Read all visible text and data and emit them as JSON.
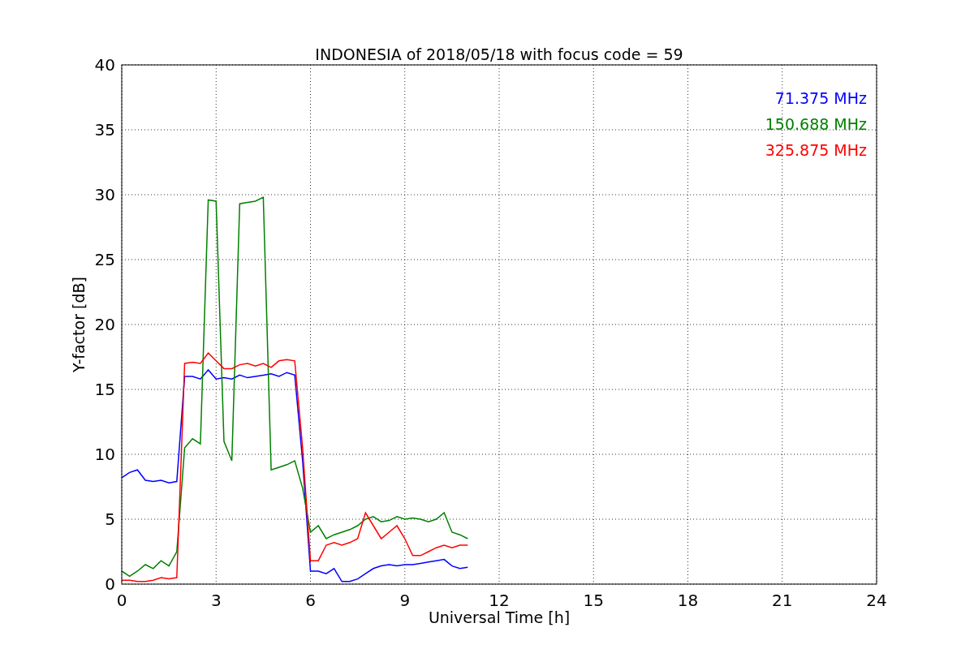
{
  "figure": {
    "chart_data": {
      "type": "line",
      "title": "INDONESIA of 2018/05/18 with focus code = 59",
      "xlabel": "Universal Time [h]",
      "ylabel": "Y-factor [dB]",
      "x": [
        0,
        0.25,
        0.5,
        0.75,
        1,
        1.25,
        1.5,
        1.75,
        2,
        2.25,
        2.5,
        2.75,
        3,
        3.25,
        3.5,
        3.75,
        4,
        4.25,
        4.5,
        4.75,
        5,
        5.25,
        5.5,
        5.75,
        6,
        6.25,
        6.5,
        6.75,
        7,
        7.25,
        7.5,
        7.75,
        8,
        8.25,
        8.5,
        8.75,
        9,
        9.25,
        9.5,
        9.75,
        10,
        10.25,
        10.5,
        10.75,
        11
      ],
      "series": [
        {
          "name": "71.375 MHz",
          "color": "#0000ff",
          "values": [
            8.2,
            8.6,
            8.8,
            8.0,
            7.9,
            8.0,
            7.8,
            7.9,
            16,
            16,
            15.8,
            16.5,
            15.8,
            15.9,
            15.8,
            16.1,
            15.9,
            16,
            16.1,
            16.2,
            16.0,
            16.3,
            16.1,
            9.5,
            1.0,
            1.0,
            0.8,
            1.2,
            0.2,
            0.2,
            0.4,
            0.8,
            1.2,
            1.4,
            1.5,
            1.4,
            1.5,
            1.5,
            1.6,
            1.7,
            1.8,
            1.9,
            1.4,
            1.2,
            1.3
          ]
        },
        {
          "name": "150.688 MHz",
          "color": "#008000",
          "values": [
            1.0,
            0.6,
            1.0,
            1.5,
            1.2,
            1.8,
            1.4,
            2.5,
            10.5,
            11.2,
            10.8,
            29.6,
            29.5,
            11,
            9.5,
            29.3,
            29.4,
            29.5,
            29.8,
            8.8,
            9.0,
            9.2,
            9.5,
            7.4,
            4.0,
            4.5,
            3.5,
            3.8,
            4.0,
            4.2,
            4.5,
            5.0,
            5.2,
            4.8,
            4.9,
            5.2,
            5.0,
            5.1,
            5.0,
            4.8,
            5.0,
            5.5,
            4.0,
            3.8,
            3.5
          ]
        },
        {
          "name": "325.875 MHz",
          "color": "#ff0000",
          "values": [
            0.3,
            0.3,
            0.2,
            0.2,
            0.3,
            0.5,
            0.4,
            0.5,
            17,
            17.1,
            17.0,
            17.8,
            17.2,
            16.6,
            16.6,
            16.9,
            17.0,
            16.8,
            17.0,
            16.7,
            17.2,
            17.3,
            17.2,
            10.5,
            1.8,
            1.8,
            3.0,
            3.2,
            3.0,
            3.2,
            3.5,
            5.5,
            4.5,
            3.5,
            4.0,
            4.5,
            3.5,
            2.2,
            2.2,
            2.5,
            2.8,
            3.0,
            2.8,
            3.0,
            3.0
          ]
        }
      ],
      "xlim": [
        0,
        24
      ],
      "ylim": [
        0,
        40
      ],
      "xticks": [
        0,
        3,
        6,
        9,
        12,
        15,
        18,
        21,
        24
      ],
      "yticks": [
        0,
        5,
        10,
        15,
        20,
        25,
        30,
        35,
        40
      ],
      "grid": true
    }
  }
}
